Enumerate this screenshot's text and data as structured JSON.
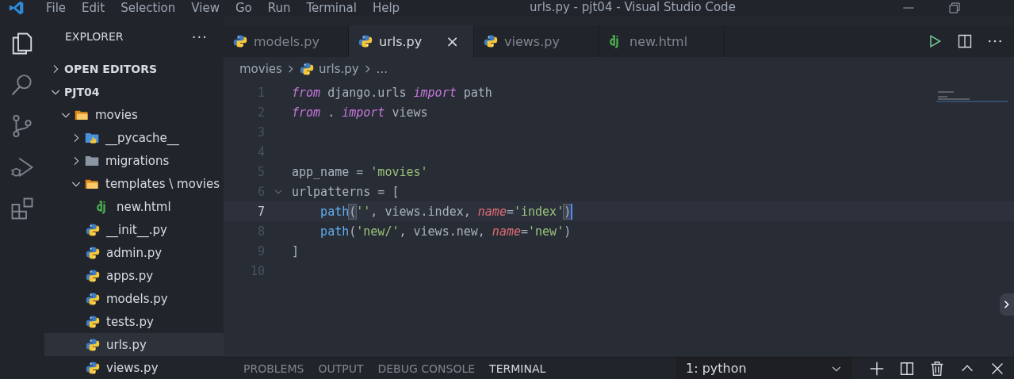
{
  "window": {
    "title": "urls.py - pjt04 - Visual Studio Code"
  },
  "menu": [
    "File",
    "Edit",
    "Selection",
    "View",
    "Go",
    "Run",
    "Terminal",
    "Help"
  ],
  "activity_bar": [
    {
      "kind": "files",
      "selected": true
    },
    {
      "kind": "search",
      "selected": false
    },
    {
      "kind": "git",
      "selected": false
    },
    {
      "kind": "debug",
      "selected": false
    },
    {
      "kind": "extensions",
      "selected": false
    }
  ],
  "sidebar": {
    "title": "EXPLORER",
    "more": "···",
    "sections": [
      {
        "label": "OPEN EDITORS",
        "expanded": false
      },
      {
        "label": "PJT04",
        "expanded": true,
        "children": [
          {
            "label": "movies",
            "kind": "folder-open",
            "expanded": true,
            "children": [
              {
                "label": "__pycache__",
                "kind": "folder-py",
                "expanded": false
              },
              {
                "label": "migrations",
                "kind": "folder",
                "expanded": false
              },
              {
                "label": "templates \\ movies",
                "kind": "folder-open",
                "expanded": true,
                "children": [
                  {
                    "label": "new.html",
                    "kind": "django",
                    "selected": false
                  }
                ]
              },
              {
                "label": "__init__.py",
                "kind": "python",
                "selected": false
              },
              {
                "label": "admin.py",
                "kind": "python",
                "selected": false
              },
              {
                "label": "apps.py",
                "kind": "python",
                "selected": false
              },
              {
                "label": "models.py",
                "kind": "python",
                "selected": false
              },
              {
                "label": "tests.py",
                "kind": "python",
                "selected": false
              },
              {
                "label": "urls.py",
                "kind": "python",
                "selected": true
              },
              {
                "label": "views.py",
                "kind": "python",
                "selected": false
              }
            ]
          }
        ]
      }
    ]
  },
  "tabs": [
    {
      "label": "models.py",
      "kind": "python",
      "selected": false
    },
    {
      "label": "urls.py",
      "kind": "python",
      "selected": true,
      "close": "×"
    },
    {
      "label": "views.py",
      "kind": "python",
      "selected": false
    },
    {
      "label": "new.html",
      "kind": "django",
      "selected": false
    }
  ],
  "breadcrumb": [
    {
      "label": "movies",
      "kind": "text"
    },
    {
      "label": "urls.py",
      "kind": "python"
    },
    {
      "label": "...",
      "kind": "text"
    }
  ],
  "code": [
    {
      "number": "1",
      "current": false,
      "tokens": [
        {
          "t": "from",
          "kind": "kw"
        },
        {
          "t": " django.urls ",
          "kind": "plain"
        },
        {
          "t": "import",
          "kind": "kw"
        },
        {
          "t": " path",
          "kind": "plain"
        }
      ]
    },
    {
      "number": "2",
      "current": false,
      "tokens": [
        {
          "t": "from",
          "kind": "kw"
        },
        {
          "t": " . ",
          "kind": "plain"
        },
        {
          "t": "import",
          "kind": "kw"
        },
        {
          "t": " views",
          "kind": "plain"
        }
      ]
    },
    {
      "number": "3",
      "current": false
    },
    {
      "number": "4",
      "current": false
    },
    {
      "number": "5",
      "current": false,
      "tokens": [
        {
          "t": "app_name = ",
          "kind": "plain"
        },
        {
          "t": "'movies'",
          "kind": "str"
        }
      ]
    },
    {
      "number": "6",
      "current": false,
      "fold": true,
      "tokens": [
        {
          "t": "urlpatterns = [",
          "kind": "plain"
        }
      ]
    },
    {
      "number": "7",
      "current": true,
      "indented": true,
      "tokens": [
        {
          "t": "path",
          "kind": "func"
        },
        {
          "t": "(",
          "kind": "bracket"
        },
        {
          "t": "''",
          "kind": "str"
        },
        {
          "t": ", views.index, ",
          "kind": "plain"
        },
        {
          "t": "name",
          "kind": "param"
        },
        {
          "t": "=",
          "kind": "plain"
        },
        {
          "t": "'index'",
          "kind": "str"
        },
        {
          "t": ")",
          "kind": "bracket"
        }
      ]
    },
    {
      "number": "8",
      "current": false,
      "indented": true,
      "tokens": [
        {
          "t": "path",
          "kind": "func"
        },
        {
          "t": "(",
          "kind": "plain"
        },
        {
          "t": "'new/'",
          "kind": "str"
        },
        {
          "t": ", views.new, ",
          "kind": "plain"
        },
        {
          "t": "name",
          "kind": "param"
        },
        {
          "t": "=",
          "kind": "plain"
        },
        {
          "t": "'new'",
          "kind": "str"
        },
        {
          "t": ")",
          "kind": "plain"
        }
      ]
    },
    {
      "number": "9",
      "current": false,
      "tokens": [
        {
          "t": "]",
          "kind": "plain"
        }
      ]
    },
    {
      "number": "10",
      "current": false
    }
  ],
  "panel": {
    "tabs": [
      {
        "label": "PROBLEMS",
        "selected": false
      },
      {
        "label": "OUTPUT",
        "selected": false
      },
      {
        "label": "DEBUG CONSOLE",
        "selected": false
      },
      {
        "label": "TERMINAL",
        "selected": true
      }
    ],
    "terminal_select": "1: python"
  }
}
